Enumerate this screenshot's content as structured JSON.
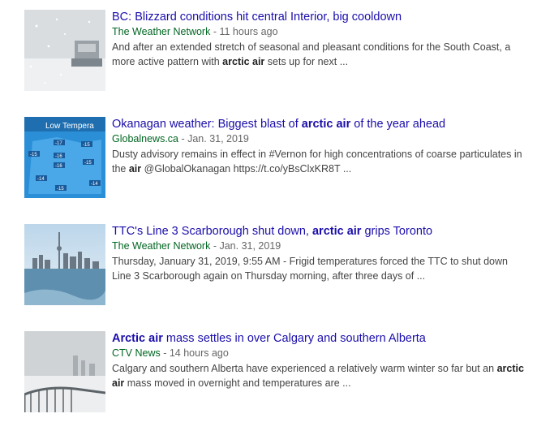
{
  "results": [
    {
      "title_parts": [
        "BC: Blizzard conditions hit central Interior, big cooldown"
      ],
      "source": "The Weather Network",
      "date": "11 hours ago",
      "snippet_parts": [
        "And after an extended stretch of seasonal and pleasant conditions for the South Coast, a more active pattern with ",
        "arctic air",
        " sets up for next ..."
      ],
      "thumbnail": "snowy-highway-thumbnail"
    },
    {
      "title_parts": [
        "Okanagan weather: Biggest blast of ",
        "arctic air",
        " of the year ahead"
      ],
      "source": "Globalnews.ca",
      "date": "Jan. 31, 2019",
      "snippet_parts": [
        "Dusty advisory remains in effect in #Vernon for high concentrations of coarse particulates in the ",
        "air",
        " @GlobalOkanagan https://t.co/yBsClxKR8T ..."
      ],
      "thumbnail": "weather-map-thumbnail",
      "thumb_caption": "Low Tempera",
      "map_labels": [
        "-17",
        "-15",
        "-15",
        "-16",
        "-16",
        "-15",
        "-14",
        "-15",
        "-14"
      ]
    },
    {
      "title_parts": [
        "TTC's Line 3 Scarborough shut down, ",
        "arctic air",
        " grips Toronto"
      ],
      "source": "The Weather Network",
      "date": "Jan. 31, 2019",
      "snippet_parts": [
        "Thursday, January 31, 2019, 9:55 AM - Frigid temperatures forced the TTC to shut down Line 3 Scarborough again on Thursday morning, after three days of ..."
      ],
      "thumbnail": "toronto-skyline-thumbnail"
    },
    {
      "title_parts": [
        "Arctic air",
        " mass settles in over Calgary and southern Alberta"
      ],
      "source": "CTV News",
      "date": "14 hours ago",
      "snippet_parts": [
        "Calgary and southern Alberta have experienced a relatively warm winter so far but an ",
        "arctic air",
        " mass moved in overnight and temperatures are ..."
      ],
      "thumbnail": "calgary-bridge-thumbnail"
    }
  ],
  "separator": " - "
}
